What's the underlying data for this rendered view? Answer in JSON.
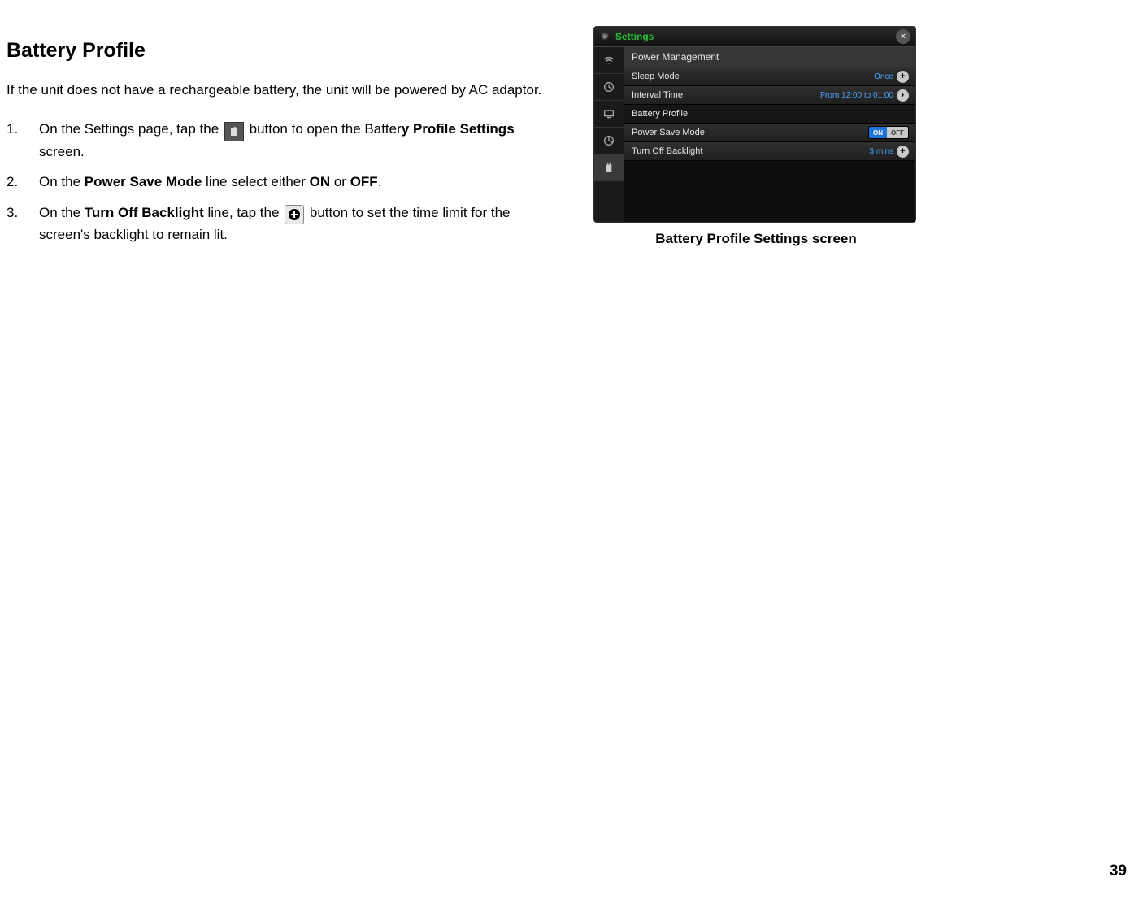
{
  "title": "Battery Profile",
  "intro": "If the unit does not have a rechargeable battery, the unit will be powered by AC adaptor.",
  "steps": {
    "s1": {
      "pre": "On the Settings page, tap the ",
      "mid": " button to open the Batter",
      "bold_tail": "y Profile Settings",
      "post": " screen."
    },
    "s2": {
      "pre": "On the ",
      "b1": "Power Save Mode",
      "mid1": " line select either ",
      "b2": "ON",
      "mid2": " or ",
      "b3": "OFF",
      "post": "."
    },
    "s3": {
      "pre": "On the ",
      "b1": "Turn Off Backlight",
      "mid1": " line, tap the ",
      "post": " button to set the time limit for the screen's backlight to remain lit."
    }
  },
  "screenshot": {
    "window_title": "Settings",
    "section_header": "Power Management",
    "rows": {
      "sleep_mode": {
        "label": "Sleep Mode",
        "value": "Once"
      },
      "interval_time": {
        "label": "Interval Time",
        "value": "From 12:00 to 01:00"
      },
      "battery_profile": {
        "label": "Battery Profile"
      },
      "power_save_mode": {
        "label": "Power Save Mode",
        "toggle_on": "ON",
        "toggle_off": "OFF"
      },
      "turn_off_backlight": {
        "label": "Turn Off Backlight",
        "value": "3 mins"
      }
    }
  },
  "figure_caption": "Battery Profile Settings screen",
  "page_number": "39"
}
